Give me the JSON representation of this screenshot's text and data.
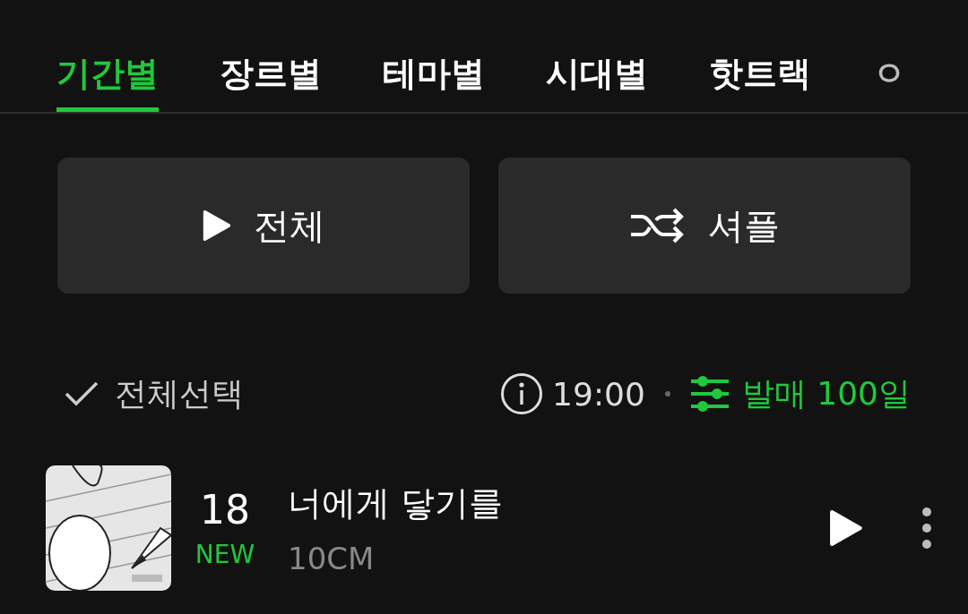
{
  "tabs": [
    {
      "label": "기간별",
      "selected": true
    },
    {
      "label": "장르별",
      "selected": false
    },
    {
      "label": "테마별",
      "selected": false
    },
    {
      "label": "시대별",
      "selected": false
    },
    {
      "label": "핫트랙",
      "selected": false
    },
    {
      "label": "ㅇ",
      "selected": false
    }
  ],
  "actions": [
    {
      "kind": "play",
      "label": "전체"
    },
    {
      "kind": "shuffle",
      "label": "셔플"
    }
  ],
  "select_all": {
    "label": "전체선택",
    "checked": false
  },
  "update_time": "19:00",
  "filter": "발매 100일",
  "songs": [
    {
      "rank": "18",
      "badge": "NEW",
      "title": "너에게 닿기를",
      "artist": "10CM"
    }
  ]
}
